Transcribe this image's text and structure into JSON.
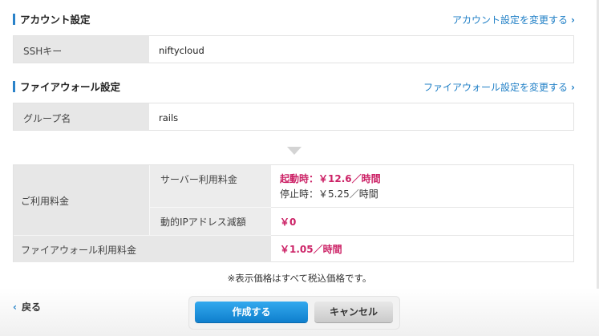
{
  "account": {
    "heading": "アカウント設定",
    "change_link": "アカウント設定を変更する",
    "ssh_key_label": "SSHキー",
    "ssh_key_value": "niftycloud"
  },
  "firewall": {
    "heading": "ファイアウォール設定",
    "change_link": "ファイアウォール設定を変更する",
    "group_label": "グループ名",
    "group_value": "rails"
  },
  "pricing": {
    "usage_label": "ご利用料金",
    "server_fee_label": "サーバー利用料金",
    "server_running": "起動時：￥12.6／時間",
    "server_stopped": "停止時：￥5.25／時間",
    "ip_discount_label": "動的IPアドレス減額",
    "ip_discount_value": "￥0",
    "firewall_fee_label": "ファイアウォール利用料金",
    "firewall_fee_value": "￥1.05／時間"
  },
  "note": "※表示価格はすべて税込価格です。",
  "footer": {
    "back_label": "戻る",
    "create_label": "作成する",
    "cancel_label": "キャンセル"
  },
  "colors": {
    "accent": "#2a82c9",
    "price_highlight": "#cc2266",
    "primary_button": "#1f8fd8"
  },
  "icons": {
    "chevron_right": "chevron-right-icon",
    "chevron_left": "chevron-left-icon",
    "down_arrow": "down-triangle-icon"
  }
}
